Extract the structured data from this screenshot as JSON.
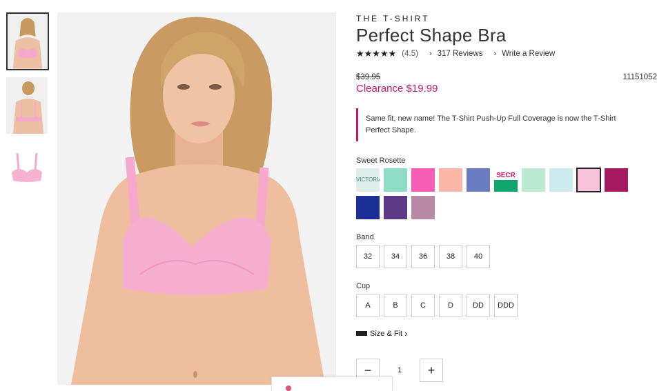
{
  "product": {
    "collection": "THE T-SHIRT",
    "title": "Perfect Shape Bra",
    "stars": "★★★★★",
    "rating": "(4.5)",
    "reviews": "317 Reviews",
    "write_review": "Write a Review",
    "old_price": "$39.95",
    "clearance": "Clearance $19.99",
    "sku": "11151052",
    "notice": "Same fit, new name! The T-Shirt Push-Up Full Coverage is now the T-Shirt Perfect Shape."
  },
  "colors": {
    "selected_label": "Sweet Rosette",
    "swatches": [
      {
        "name": "print-script",
        "hex": "#dfeeea",
        "text": "VICTORIA'S"
      },
      {
        "name": "mint",
        "hex": "#8fdcc4",
        "text": ""
      },
      {
        "name": "hot-pink",
        "hex": "#f65eb3",
        "text": ""
      },
      {
        "name": "peach",
        "hex": "#fcb7a9",
        "text": ""
      },
      {
        "name": "periwinkle",
        "hex": "#6a7cc0",
        "text": ""
      },
      {
        "name": "secret-green",
        "hex": "#10a56e",
        "text": "SECR"
      },
      {
        "name": "pale-mint",
        "hex": "#bde8d2",
        "text": ""
      },
      {
        "name": "pale-blue",
        "hex": "#cdebee",
        "text": ""
      },
      {
        "name": "sweet-rosette",
        "hex": "#f8c2d8",
        "text": ""
      },
      {
        "name": "berry",
        "hex": "#a4195f",
        "text": ""
      },
      {
        "name": "navy",
        "hex": "#1c2f95",
        "text": ""
      },
      {
        "name": "purple",
        "hex": "#5c3a85",
        "text": ""
      },
      {
        "name": "mauve",
        "hex": "#b78aa5",
        "text": ""
      }
    ],
    "selected_index": 8
  },
  "band": {
    "label": "Band",
    "sizes": [
      "32",
      "34",
      "36",
      "38",
      "40"
    ]
  },
  "cup": {
    "label": "Cup",
    "sizes": [
      "A",
      "B",
      "C",
      "D",
      "DD",
      "DDD"
    ]
  },
  "fit": {
    "label": "Size & Fit",
    "chevron": "›"
  },
  "quantity": {
    "minus": "−",
    "value": "1",
    "plus": "+"
  },
  "accent": "#c8175d"
}
